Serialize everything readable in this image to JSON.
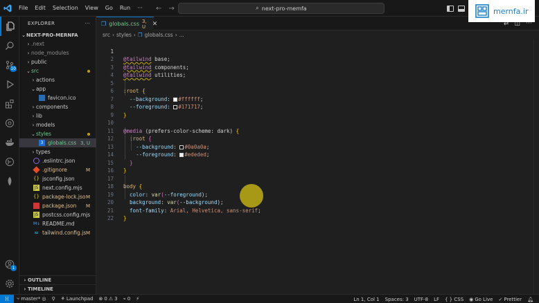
{
  "titlebar": {
    "menu": [
      "File",
      "Edit",
      "Selection",
      "View",
      "Go",
      "Run",
      "···"
    ],
    "search": "next-pro-memfa"
  },
  "watermark": {
    "text": "mernfa.ir"
  },
  "activity": {
    "source_control_badge": "10",
    "accounts_badge": "1"
  },
  "explorer": {
    "title": "EXPLORER",
    "more": "···",
    "root": "NEXT-PRO-MERNFA",
    "rows": [
      {
        "label": ".next",
        "status": ""
      },
      {
        "label": "node_modules",
        "status": ""
      },
      {
        "label": "public",
        "status": ""
      },
      {
        "label": "src",
        "status": ""
      },
      {
        "label": "actions",
        "status": ""
      },
      {
        "label": "app",
        "status": ""
      },
      {
        "label": "favicon.ico",
        "status": ""
      },
      {
        "label": "components",
        "status": ""
      },
      {
        "label": "lib",
        "status": ""
      },
      {
        "label": "models",
        "status": ""
      },
      {
        "label": "styles",
        "status": ""
      },
      {
        "label": "globals.css",
        "status": "3, U"
      },
      {
        "label": "types",
        "status": ""
      },
      {
        "label": ".eslintrc.json",
        "status": ""
      },
      {
        "label": ".gitignore",
        "status": "M"
      },
      {
        "label": "jsconfig.json",
        "status": ""
      },
      {
        "label": "next.config.mjs",
        "status": ""
      },
      {
        "label": "package-lock.json",
        "status": "M"
      },
      {
        "label": "package.json",
        "status": "M"
      },
      {
        "label": "postcss.config.mjs",
        "status": ""
      },
      {
        "label": "README.md",
        "status": ""
      },
      {
        "label": "tailwind.config.js",
        "status": "M"
      }
    ],
    "outline": "OUTLINE",
    "timeline": "TIMELINE"
  },
  "tab": {
    "name": "globals.css",
    "status": "3, U"
  },
  "breadcrumb": [
    "src",
    "styles",
    "globals.css",
    "..."
  ],
  "editor": {
    "line_numbers": [
      "1",
      "2",
      "3",
      "4",
      "5",
      "6",
      "7",
      "8",
      "9",
      "10",
      "11",
      "12",
      "13",
      "14",
      "15",
      "16",
      "17",
      "18",
      "19",
      "20",
      "21",
      "22"
    ],
    "colors": {
      "white": "#ffffff",
      "dark": "#171717",
      "dark_bg": "#0a0a0a",
      "light_fg": "#ededed"
    },
    "code": {
      "l1a": "@tailwind",
      "l1b": " base;",
      "l2a": "@tailwind",
      "l2b": " components;",
      "l3a": "@tailwind",
      "l3b": " utilities;",
      "l5a": ":root",
      "l5b": " {",
      "l6a": "--background",
      "l6b": ": ",
      "l6c": "#ffffff",
      "l6d": ";",
      "l7a": "--foreground",
      "l7b": ": ",
      "l7c": "#171717",
      "l7d": ";",
      "l8": "}",
      "l10a": "@media",
      "l10b": " (prefers-color-scheme: dark) ",
      "l10c": "{",
      "l11a": ":root",
      "l11b": " {",
      "l12a": "--background",
      "l12b": ": ",
      "l12c": "#0a0a0a",
      "l12d": ";",
      "l13a": "--foreground",
      "l13b": ": ",
      "l13c": "#ededed",
      "l13d": ";",
      "l14": "}",
      "l15": "}",
      "l17a": "body",
      "l17b": " {",
      "l18a": "color",
      "l18b": ": ",
      "l18c": "var",
      "l18d": "(",
      "l18e": "--foreground",
      "l18f": ");",
      "l19a": "background",
      "l19b": ": ",
      "l19c": "var",
      "l19d": "(",
      "l19e": "--background",
      "l19f": ");",
      "l20a": "font-family",
      "l20b": ": ",
      "l20c": "Arial, Helvetica, sans-serif",
      "l20d": ";",
      "l21": "}"
    }
  },
  "status": {
    "branch": "master*",
    "launchpad": "Launchpad",
    "errors": "0",
    "warnings": "3",
    "ports": "0",
    "position": "Ln 1, Col 1",
    "spaces": "Spaces: 3",
    "encoding": "UTF-8",
    "eol": "LF",
    "language": "{ } CSS",
    "golive": "Go Live",
    "prettier": "Prettier"
  }
}
